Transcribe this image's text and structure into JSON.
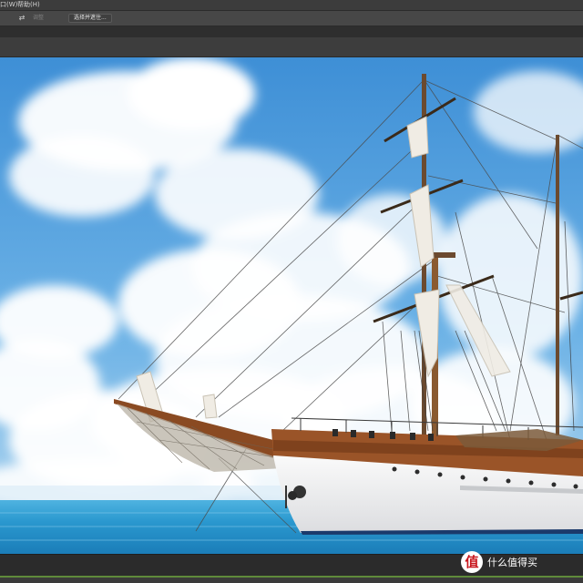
{
  "menubar": {
    "items": [
      {
        "label": "口(W)"
      },
      {
        "label": "帮助(H)"
      }
    ]
  },
  "options_bar": {
    "tool_icon": "swap-arrows-icon",
    "field_label": "调整",
    "button_label": "选择并遮住..."
  },
  "watermark": {
    "logo_text": "值",
    "text": "什么值得买"
  },
  "colors": {
    "sky": "#4a98d8",
    "sea": "#2f95c8",
    "hull": "#f3f3f1",
    "deck_wood": "#8a4a22",
    "ui_dark": "#262626"
  }
}
